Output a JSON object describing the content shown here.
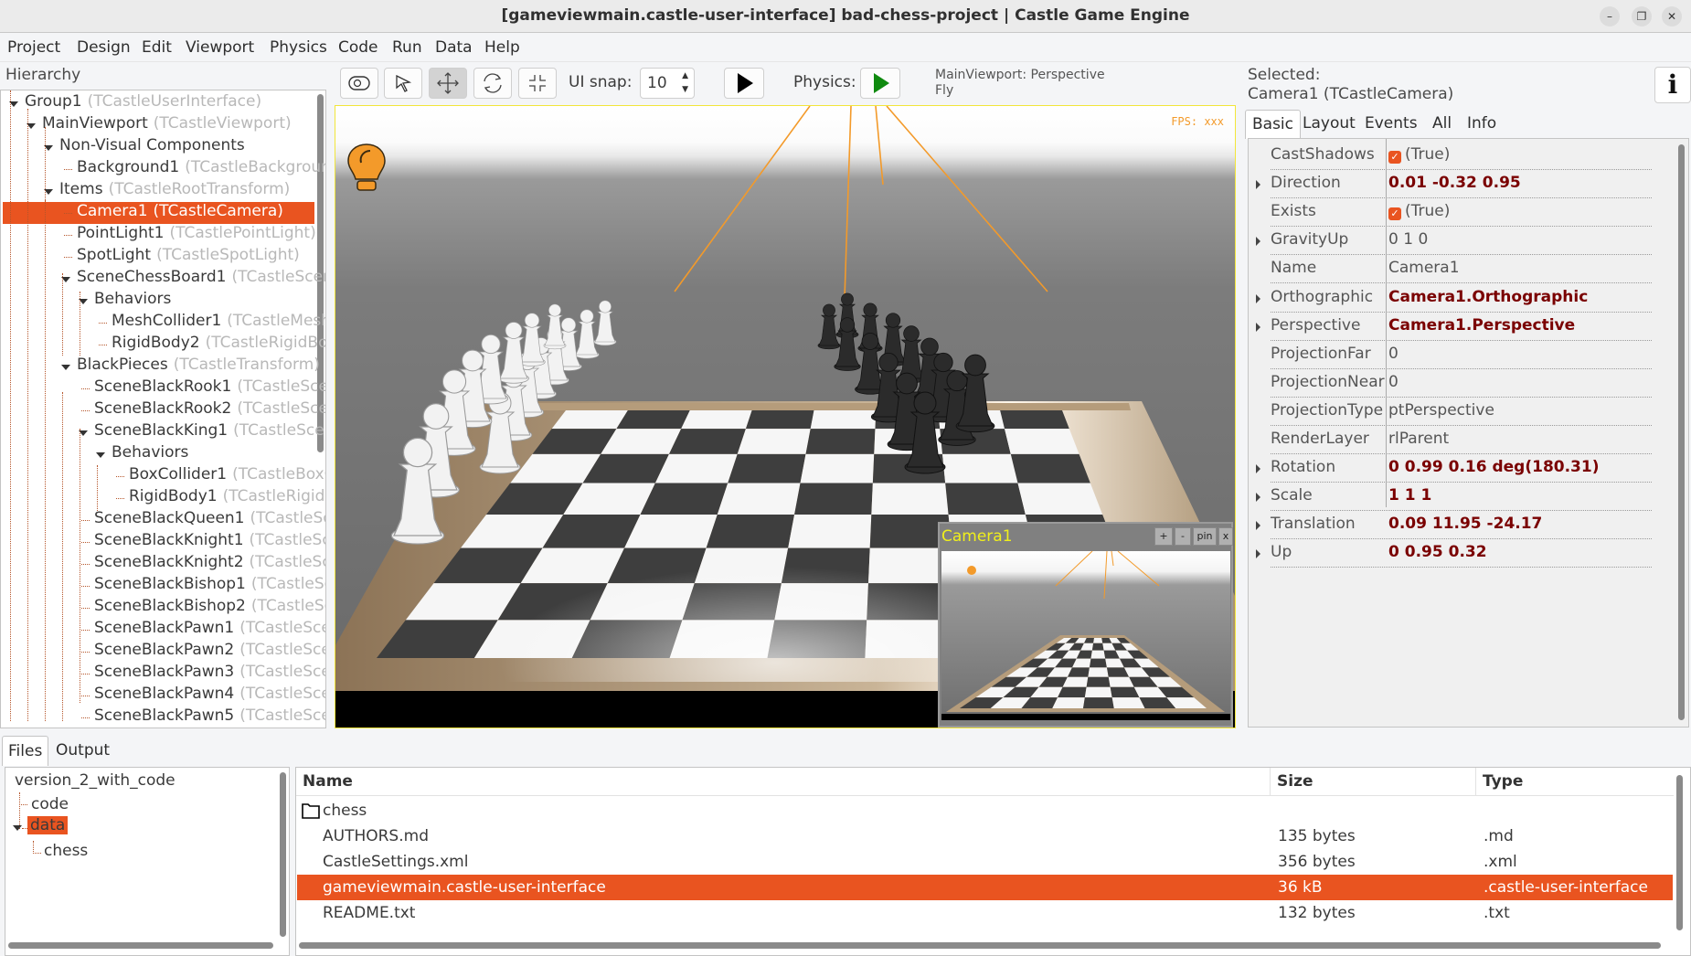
{
  "window": {
    "title": "[gameviewmain.castle-user-interface] bad-chess-project | Castle Game Engine",
    "controls": [
      "minimize",
      "maximize",
      "close"
    ]
  },
  "menu": [
    "Project",
    "Design",
    "Edit",
    "Viewport",
    "Physics",
    "Code",
    "Run",
    "Data",
    "Help"
  ],
  "hierarchy": {
    "label": "Hierarchy",
    "items": [
      {
        "name": "Group1",
        "type": "(TCastleUserInterface)",
        "level": 0,
        "expanded": true
      },
      {
        "name": "MainViewport",
        "type": "(TCastleViewport)",
        "level": 1,
        "expanded": true
      },
      {
        "name": "Non-Visual Components",
        "type": "",
        "level": 2,
        "expanded": true
      },
      {
        "name": "Background1",
        "type": "(TCastleBackground)",
        "level": 3
      },
      {
        "name": "Items",
        "type": "(TCastleRootTransform)",
        "level": 2,
        "expanded": true
      },
      {
        "name": "Camera1",
        "type": "(TCastleCamera)",
        "level": 3,
        "selected": true
      },
      {
        "name": "PointLight1",
        "type": "(TCastlePointLight)",
        "level": 3
      },
      {
        "name": "SpotLight",
        "type": "(TCastleSpotLight)",
        "level": 3
      },
      {
        "name": "SceneChessBoard1",
        "type": "(TCastleScene)",
        "level": 3,
        "expanded": true
      },
      {
        "name": "Behaviors",
        "type": "",
        "level": 4,
        "expanded": true
      },
      {
        "name": "MeshCollider1",
        "type": "(TCastleMeshCollider)",
        "level": 5
      },
      {
        "name": "RigidBody2",
        "type": "(TCastleRigidBody)",
        "level": 5
      },
      {
        "name": "BlackPieces",
        "type": "(TCastleTransform)",
        "level": 3,
        "expanded": true
      },
      {
        "name": "SceneBlackRook1",
        "type": "(TCastleScene)",
        "level": 4
      },
      {
        "name": "SceneBlackRook2",
        "type": "(TCastleScene)",
        "level": 4
      },
      {
        "name": "SceneBlackKing1",
        "type": "(TCastleScene)",
        "level": 4,
        "expanded": true
      },
      {
        "name": "Behaviors",
        "type": "",
        "level": 5,
        "expanded": true
      },
      {
        "name": "BoxCollider1",
        "type": "(TCastleBoxCollider)",
        "level": 6
      },
      {
        "name": "RigidBody1",
        "type": "(TCastleRigidBody)",
        "level": 6
      },
      {
        "name": "SceneBlackQueen1",
        "type": "(TCastleScene)",
        "level": 4
      },
      {
        "name": "SceneBlackKnight1",
        "type": "(TCastleScene)",
        "level": 4
      },
      {
        "name": "SceneBlackKnight2",
        "type": "(TCastleScene)",
        "level": 4
      },
      {
        "name": "SceneBlackBishop1",
        "type": "(TCastleScene)",
        "level": 4
      },
      {
        "name": "SceneBlackBishop2",
        "type": "(TCastleScene)",
        "level": 4
      },
      {
        "name": "SceneBlackPawn1",
        "type": "(TCastleScene)",
        "level": 4
      },
      {
        "name": "SceneBlackPawn2",
        "type": "(TCastleScene)",
        "level": 4
      },
      {
        "name": "SceneBlackPawn3",
        "type": "(TCastleScene)",
        "level": 4
      },
      {
        "name": "SceneBlackPawn4",
        "type": "(TCastleScene)",
        "level": 4
      },
      {
        "name": "SceneBlackPawn5",
        "type": "(TCastleScene)",
        "level": 4
      }
    ]
  },
  "toolbar": {
    "tools": [
      "interact",
      "select",
      "translate",
      "rotate",
      "scale"
    ],
    "active_tool": "translate",
    "ui_snap_label": "UI snap:",
    "ui_snap_value": "10",
    "physics_label": "Physics:",
    "viewport_info_line1": "MainViewport: Perspective",
    "viewport_info_line2": "Fly"
  },
  "viewport": {
    "fps_text": "FPS: xxx",
    "camera_preview": {
      "title": "Camera1",
      "buttons": [
        "+",
        "-",
        "pin",
        "x"
      ]
    }
  },
  "inspector": {
    "selected_label": "Selected:",
    "selected_value": "Camera1 (TCastleCamera)",
    "info_button": "i",
    "tabs": [
      "Basic",
      "Layout",
      "Events",
      "All",
      "Info"
    ],
    "active_tab": "Basic",
    "properties": [
      {
        "key": "CastShadows",
        "value": "(True)",
        "checkbox": true,
        "expandable": false,
        "modified": false
      },
      {
        "key": "Direction",
        "value": "0.01 -0.32 0.95",
        "expandable": true,
        "modified": true
      },
      {
        "key": "Exists",
        "value": "(True)",
        "checkbox": true,
        "expandable": false,
        "modified": false
      },
      {
        "key": "GravityUp",
        "value": "0 1 0",
        "expandable": true,
        "modified": false
      },
      {
        "key": "Name",
        "value": "Camera1",
        "expandable": false,
        "modified": false
      },
      {
        "key": "Orthographic",
        "value": "Camera1.Orthographic",
        "expandable": true,
        "modified": true
      },
      {
        "key": "Perspective",
        "value": "Camera1.Perspective",
        "expandable": true,
        "modified": true
      },
      {
        "key": "ProjectionFar",
        "value": "0",
        "expandable": false,
        "modified": false
      },
      {
        "key": "ProjectionNear",
        "value": "0",
        "expandable": false,
        "modified": false
      },
      {
        "key": "ProjectionType",
        "value": "ptPerspective",
        "expandable": false,
        "modified": false
      },
      {
        "key": "RenderLayer",
        "value": "rlParent",
        "expandable": false,
        "modified": false
      },
      {
        "key": "Rotation",
        "value": "0 0.99 0.16 deg(180.31)",
        "expandable": true,
        "modified": true
      },
      {
        "key": "Scale",
        "value": "1 1 1",
        "expandable": true,
        "modified": true
      },
      {
        "key": "Translation",
        "value": "0.09 11.95 -24.17",
        "expandable": true,
        "modified": true
      },
      {
        "key": "Up",
        "value": "0 0.95 0.32",
        "expandable": true,
        "modified": true
      }
    ]
  },
  "bottom": {
    "tabs": [
      "Files",
      "Output"
    ],
    "active_tab": "Files",
    "folder_tree": [
      {
        "name": "version_2_with_code",
        "level": 0
      },
      {
        "name": "code",
        "level": 1
      },
      {
        "name": "data",
        "level": 1,
        "selected": true,
        "expanded": true
      },
      {
        "name": "chess",
        "level": 2
      }
    ],
    "file_columns": [
      "Name",
      "Size",
      "Type"
    ],
    "files": [
      {
        "name": "chess",
        "size": "",
        "type": "",
        "folder": true
      },
      {
        "name": "AUTHORS.md",
        "size": "135 bytes",
        "type": ".md"
      },
      {
        "name": "CastleSettings.xml",
        "size": "356 bytes",
        "type": ".xml"
      },
      {
        "name": "gameviewmain.castle-user-interface",
        "size": "36 kB",
        "type": ".castle-user-interface",
        "selected": true
      },
      {
        "name": "README.txt",
        "size": "132 bytes",
        "type": ".txt"
      }
    ]
  },
  "colors": {
    "accent": "#e95420",
    "modified_value": "#7a0000",
    "viewport_border": "#f2e63a",
    "gizmo_orange": "#f39a2a",
    "physics_play": "#0f8a0f"
  }
}
